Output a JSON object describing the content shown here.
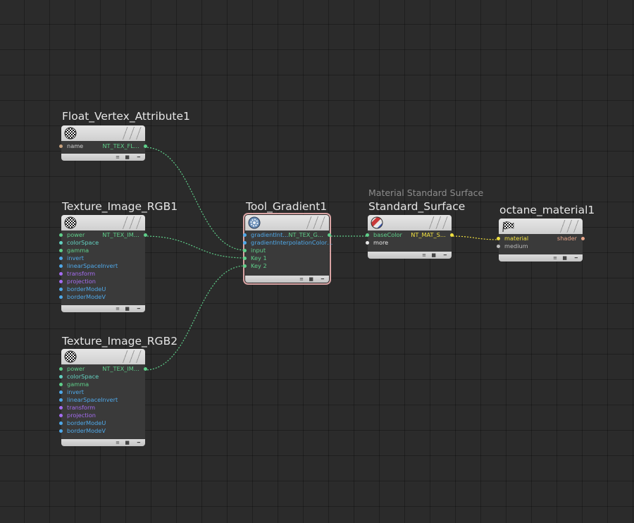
{
  "nodes": {
    "float_vertex": {
      "title": "Float_Vertex_Attribute1",
      "inputs": [
        {
          "label": "name",
          "color": "#c8a27e"
        }
      ],
      "output": {
        "label": "NT_TEX_FL…",
        "color": "#5fcf8a"
      }
    },
    "tex_rgb1": {
      "title": "Texture_Image_RGB1",
      "inputs": [
        {
          "label": "power",
          "color": "#5fcf8a"
        },
        {
          "label": "colorSpace",
          "color": "#63d0c0"
        },
        {
          "label": "gamma",
          "color": "#5fcf8a"
        },
        {
          "label": "invert",
          "color": "#4fa8e8"
        },
        {
          "label": "linearSpaceInvert",
          "color": "#4fa8e8"
        },
        {
          "label": "transform",
          "color": "#a46cf0"
        },
        {
          "label": "projection",
          "color": "#a46cf0"
        },
        {
          "label": "borderModeU",
          "color": "#4fa8e8"
        },
        {
          "label": "borderModeV",
          "color": "#4fa8e8"
        }
      ],
      "output": {
        "label": "NT_TEX_IM…",
        "color": "#5fcf8a"
      }
    },
    "tex_rgb2": {
      "title": "Texture_Image_RGB2",
      "inputs": [
        {
          "label": "power",
          "color": "#5fcf8a"
        },
        {
          "label": "colorSpace",
          "color": "#63d0c0"
        },
        {
          "label": "gamma",
          "color": "#5fcf8a"
        },
        {
          "label": "invert",
          "color": "#4fa8e8"
        },
        {
          "label": "linearSpaceInvert",
          "color": "#4fa8e8"
        },
        {
          "label": "transform",
          "color": "#a46cf0"
        },
        {
          "label": "projection",
          "color": "#a46cf0"
        },
        {
          "label": "borderModeU",
          "color": "#4fa8e8"
        },
        {
          "label": "borderModeV",
          "color": "#4fa8e8"
        }
      ],
      "output": {
        "label": "NT_TEX_IM…",
        "color": "#5fcf8a"
      }
    },
    "tool_gradient": {
      "title": "Tool_Gradient1",
      "inputs": [
        {
          "label": "gradientInt…",
          "color": "#4fa8e8"
        },
        {
          "label": "gradientInterpolationColor…",
          "color": "#4fa8e8"
        },
        {
          "label": "input",
          "color": "#5fcf8a"
        },
        {
          "label": "Key 1",
          "color": "#5fcf8a"
        },
        {
          "label": "Key 2",
          "color": "#5fcf8a"
        }
      ],
      "output": {
        "label": "NT_TEX_G…",
        "color": "#5fcf8a"
      }
    },
    "standard_surface": {
      "subtitle": "Material Standard Surface",
      "title": "Standard_Surface",
      "inputs": [
        {
          "label": "baseColor",
          "color": "#5fcf8a"
        },
        {
          "label": "more",
          "color": "#e8e8e8"
        }
      ],
      "output": {
        "label": "NT_MAT_S…",
        "color": "#f0e040"
      }
    },
    "octane_material": {
      "title": "octane_material1",
      "inputs": [
        {
          "label": "material",
          "color": "#f0e040"
        },
        {
          "label": "medium",
          "color": "#bbbbbb"
        }
      ],
      "output": {
        "label": "shader",
        "color": "#e8a58a"
      }
    }
  },
  "colors": {
    "background": "#2b2b2b",
    "node_body": "#3a3a3a",
    "node_header": "#d8d8d8",
    "wire_green": "#5fcf8a",
    "wire_yellow": "#f0e040",
    "selection": "#d9a3a3"
  },
  "icons": {
    "texture": "checker-sphere-icon",
    "gradient": "gear-sphere-icon",
    "surface": "striped-ball-icon",
    "material": "checkered-flag-icon"
  },
  "footer_glyphs": [
    "≡",
    "■",
    "━"
  ]
}
